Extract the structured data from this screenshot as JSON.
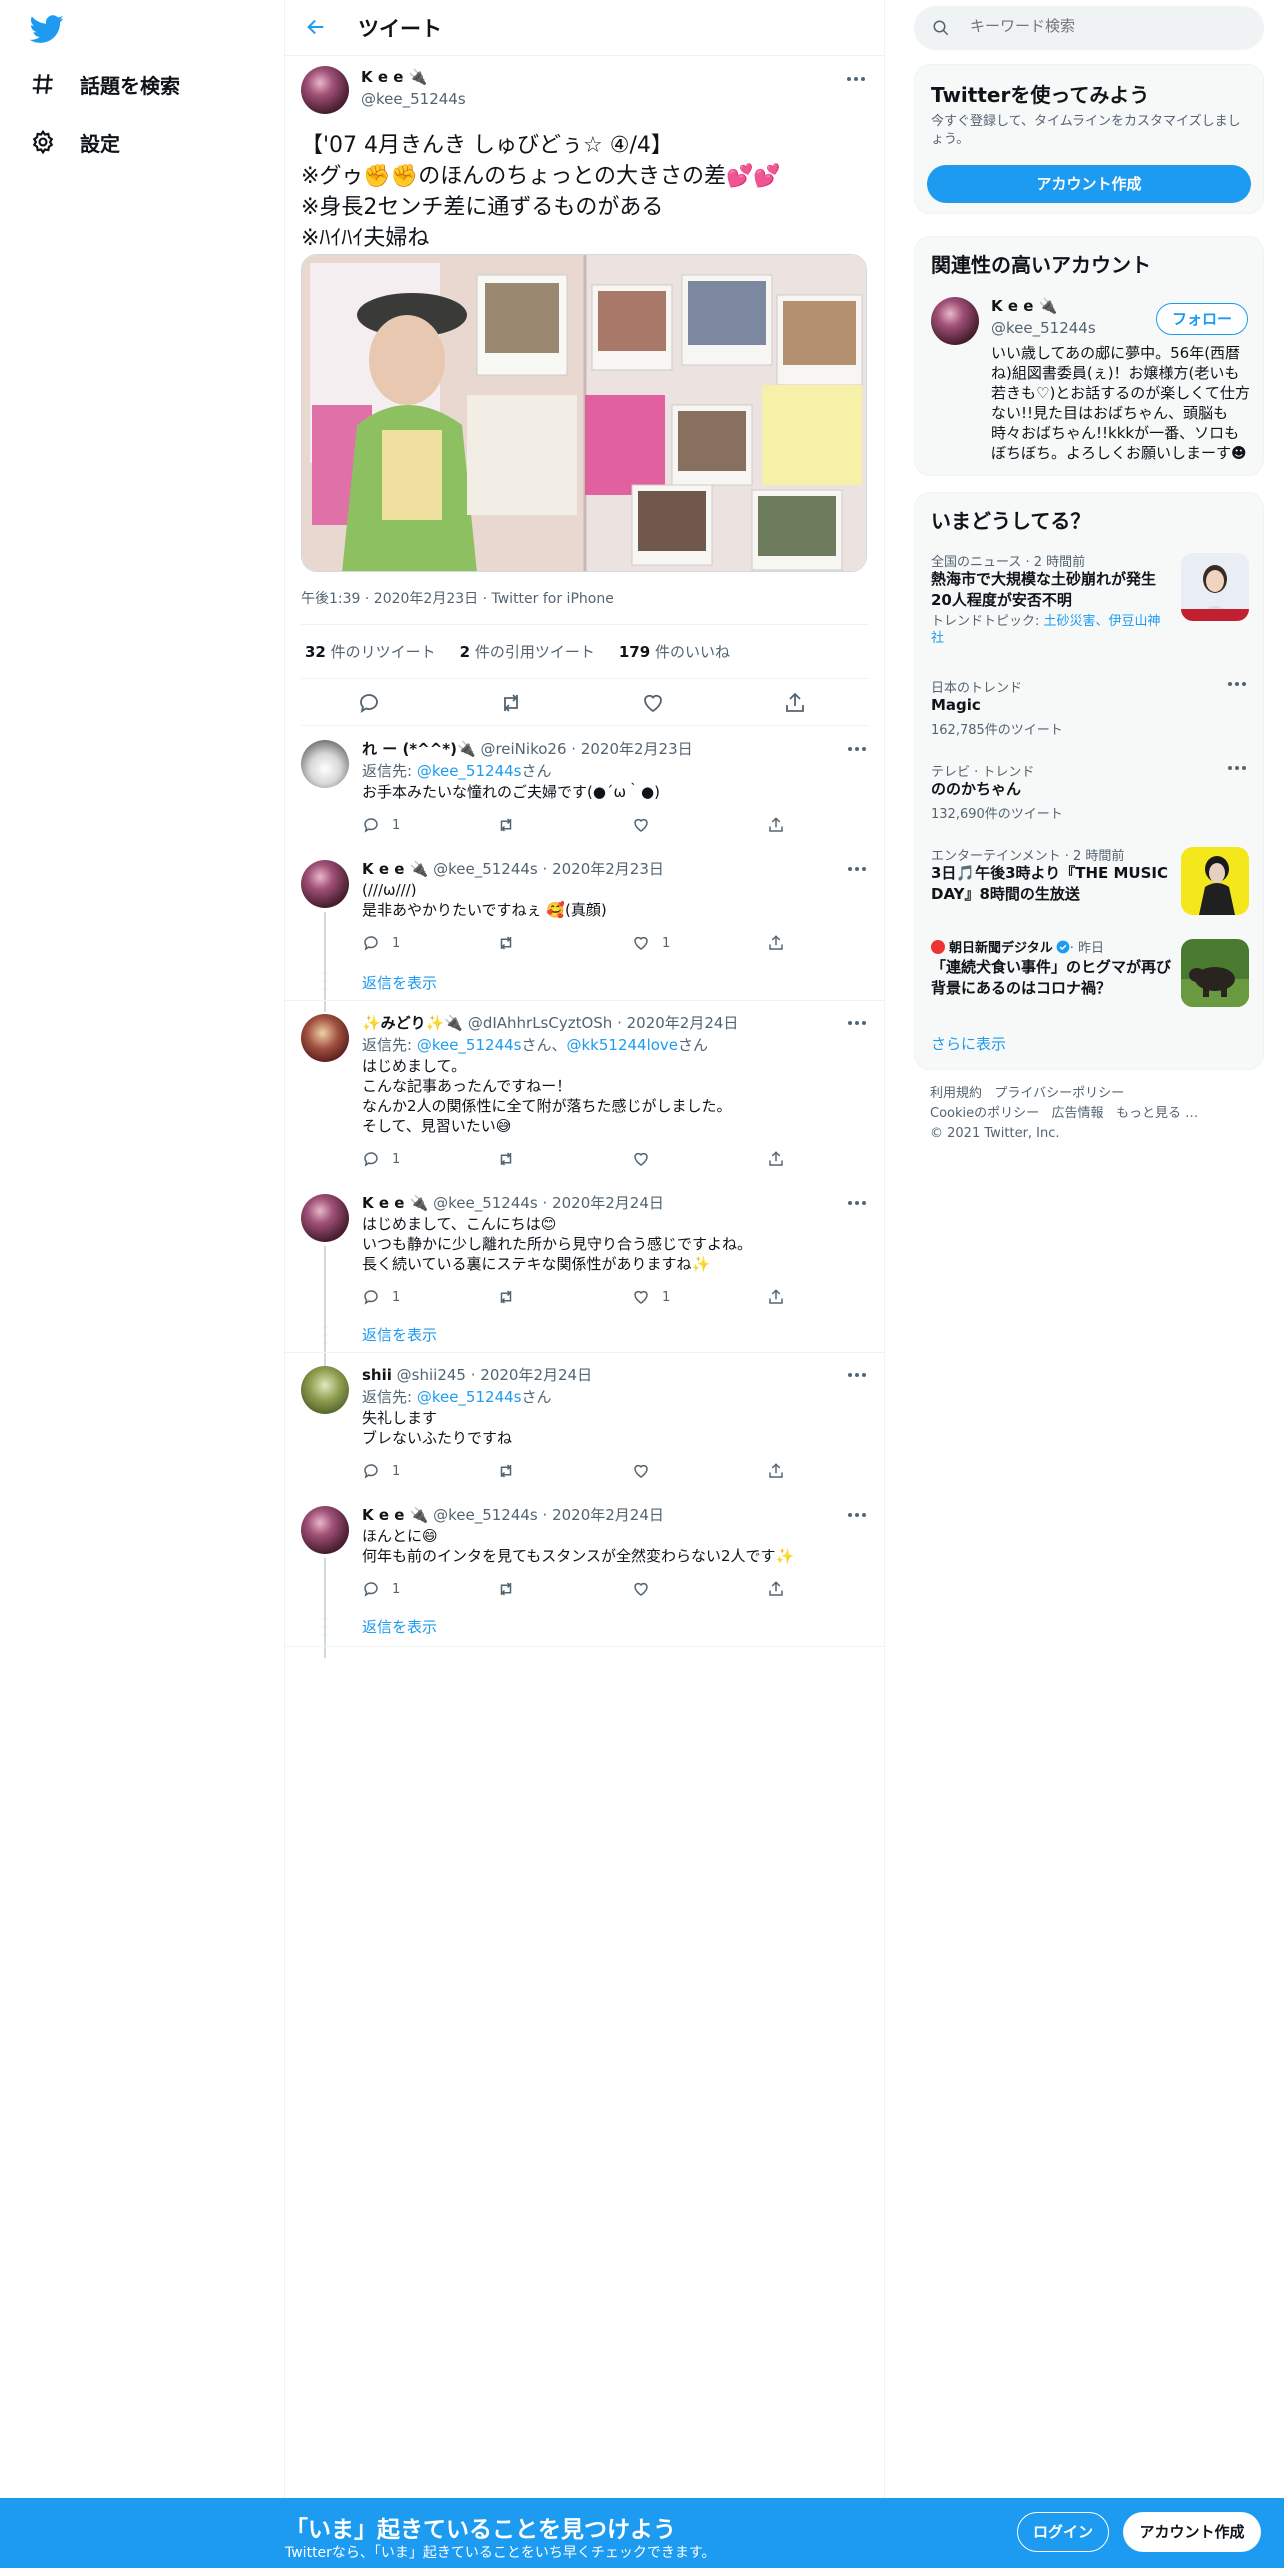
{
  "colors": {
    "accent": "#1d9bf0",
    "text": "#0f1419",
    "muted": "#536471",
    "border": "#eff3f4"
  },
  "nav": [
    {
      "label": "話題を検索",
      "icon": "hashtag-icon"
    },
    {
      "label": "設定",
      "icon": "gear-icon"
    }
  ],
  "header": {
    "title": "ツイート"
  },
  "tweet": {
    "author_name": "K e e 🔌",
    "handle": "@kee_51244s",
    "text": "【'07 4月きんき しゅびどぅ☆ ④/4】\n※グゥ✊✊のほんのちょっとの大きさの差💕💕\n※身長2センチ差に通ずるものがある\n※ﾊｲﾊｲ夫婦ね",
    "meta": "午後1:39 · 2020年2月23日 · Twitter for iPhone",
    "retweets_count": "32",
    "retweets_label": " 件のリツイート",
    "quotes_count": "2",
    "quotes_label": " 件の引用ツイート",
    "likes_count": "179",
    "likes_label": " 件のいいね"
  },
  "replies": [
    {
      "name": "れ ー (*^^*)🔌",
      "handle": "@reiNiko26",
      "date": "2020年2月23日",
      "reply_to_label": "返信先: ",
      "reply_to": "@kee_51244s",
      "reply_to_suffix": "さん",
      "text": "お手本みたいな憧れのご夫婦です(●´ω｀●)",
      "replies": "1",
      "retweets": "",
      "likes": ""
    },
    {
      "name": "K e e 🔌",
      "handle": "@kee_51244s",
      "date": "2020年2月23日",
      "text": "(///ω///)\n是非あやかりたいですねぇ 🥰(真顔)",
      "replies": "1",
      "retweets": "",
      "likes": "1",
      "show_more": "返信を表示"
    },
    {
      "name": "✨みどり✨🔌",
      "handle": "@dIAhhrLsCyztOSh",
      "date": "2020年2月24日",
      "reply_to_label": "返信先: ",
      "reply_to": "@kee_51244s",
      "reply_to_mid": "さん、",
      "reply_to2": "@kk51244love",
      "reply_to_suffix": "さん",
      "text": "はじめまして。\nこんな記事あったんですねー！\nなんか2人の関係性に全て附が落ちた感じがしました。\nそして、見習いたい😅",
      "replies": "1",
      "retweets": "",
      "likes": ""
    },
    {
      "name": "K e e 🔌",
      "handle": "@kee_51244s",
      "date": "2020年2月24日",
      "text": "はじめまして、こんにちは😊\nいつも静かに少し離れた所から見守り合う感じですよね。\n長く続いている裏にステキな関係性がありますね✨",
      "replies": "1",
      "retweets": "",
      "likes": "1",
      "show_more": "返信を表示"
    },
    {
      "name": "shii",
      "handle": "@shii245",
      "date": "2020年2月24日",
      "reply_to_label": "返信先: ",
      "reply_to": "@kee_51244s",
      "reply_to_suffix": "さん",
      "text": "失礼します\nブレないふたりですね",
      "replies": "1",
      "retweets": "",
      "likes": ""
    },
    {
      "name": "K e e 🔌",
      "handle": "@kee_51244s",
      "date": "2020年2月24日",
      "text": "ほんとに😄\n何年も前のインタを見てもスタンスが全然変わらない2人です✨",
      "replies": "1",
      "retweets": "",
      "likes": "",
      "show_more": "返信を表示"
    }
  ],
  "sidebar": {
    "search_placeholder": "キーワード検索",
    "signup_card": {
      "title": "Twitterを使ってみよう",
      "text": "今すぐ登録して、タイムラインをカスタマイズしましょう。",
      "button": "アカウント作成"
    },
    "related": {
      "title": "関連性の高いアカウント",
      "name": "K e e 🔌",
      "handle": "@kee_51244s",
      "follow": "フォロー",
      "bio": "いい歳してあの郕に夢中。56年(西暦ね)組図書委員(ぇ)！お嬢様方(老いも若きも♡)とお話するのが楽しくて仕方ない!!見た目はおばちゃん、頭脳も時々おばちゃん!!kkkが一番、ソロもぼちぼち。よろしくお願いしまーす☻"
    },
    "trends": {
      "title": "いまどうしてる？",
      "items": [
        {
          "meta": "全国のニュース · 2 時間前",
          "title": "熱海市で大規模な土砂崩れが発生 20人程度が安否不明",
          "sub_prefix": "トレンドトピック: ",
          "sub_link": "土砂災害、伊豆山神社",
          "thumb": "news-thumb"
        },
        {
          "meta": "日本のトレンド",
          "title": "Magic",
          "sub": "162,785件のツイート"
        },
        {
          "meta": "テレビ · トレンド",
          "title": "ののかちゃん",
          "sub": "132,690件のツイート"
        },
        {
          "meta": "エンターテインメント · 2 時間前",
          "title": "3日🎵午後3時より『THE MUSIC DAY』8時間の生放送",
          "thumb": "music-thumb"
        },
        {
          "meta_source": "朝日新聞デジタル",
          "meta_time": " · 昨日",
          "title": "「連続犬食い事件」のヒグマが再び　背景にあるのはコロナ禍？",
          "thumb": "bear-thumb"
        }
      ],
      "show_more": "さらに表示"
    },
    "footer": {
      "links1": [
        "利用規約",
        "プライバシーポリシー"
      ],
      "links2": [
        "Cookieのポリシー",
        "広告情報",
        "もっと見る …"
      ],
      "copyright": "© 2021 Twitter, Inc."
    }
  },
  "banner": {
    "headline": "「いま」起きていることを見つけよう",
    "sub": "Twitterなら、「いま」起きていることをいち早くチェックできます。",
    "login": "ログイン",
    "signup": "アカウント作成"
  }
}
